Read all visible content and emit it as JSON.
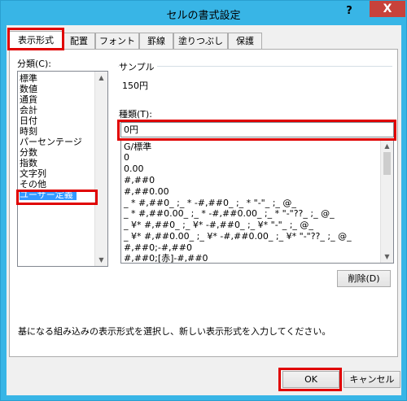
{
  "window": {
    "title": "セルの書式設定",
    "help_label": "?",
    "close_label": "X"
  },
  "tabs": [
    {
      "label": "表示形式"
    },
    {
      "label": "配置"
    },
    {
      "label": "フォント"
    },
    {
      "label": "罫線"
    },
    {
      "label": "塗りつぶし"
    },
    {
      "label": "保護"
    }
  ],
  "category": {
    "label": "分類(C):",
    "items": [
      "標準",
      "数値",
      "通貨",
      "会計",
      "日付",
      "時刻",
      "パーセンテージ",
      "分数",
      "指数",
      "文字列",
      "その他",
      "ユーザー定義"
    ],
    "selected": "ユーザー定義"
  },
  "sample": {
    "label": "サンプル",
    "value": "150円"
  },
  "type": {
    "label": "種類(T):",
    "value": "0円"
  },
  "formats": [
    "G/標準",
    "0",
    "0.00",
    "#,##0",
    "#,##0.00",
    "_ * #,##0_ ;_ * -#,##0_ ;_ * \"-\"_ ;_ @_",
    "_ * #,##0.00_ ;_ * -#,##0.00_ ;_ * \"-\"??_ ;_ @_",
    "_ ¥* #,##0_ ;_ ¥* -#,##0_ ;_ ¥* \"-\"_ ;_ @_",
    "_ ¥* #,##0.00_ ;_ ¥* -#,##0.00_ ;_ ¥* \"-\"??_ ;_ @_",
    "#,##0;-#,##0",
    "#,##0;[赤]-#,##0"
  ],
  "buttons": {
    "delete_label": "削除(D)",
    "ok_label": "OK",
    "cancel_label": "キャンセル"
  },
  "description": "基になる組み込みの表示形式を選択し、新しい表示形式を入力してください。",
  "colors": {
    "titlebar": "#38b5e6",
    "close": "#c7423b",
    "highlight": "#e00000",
    "selection": "#3399ff"
  }
}
